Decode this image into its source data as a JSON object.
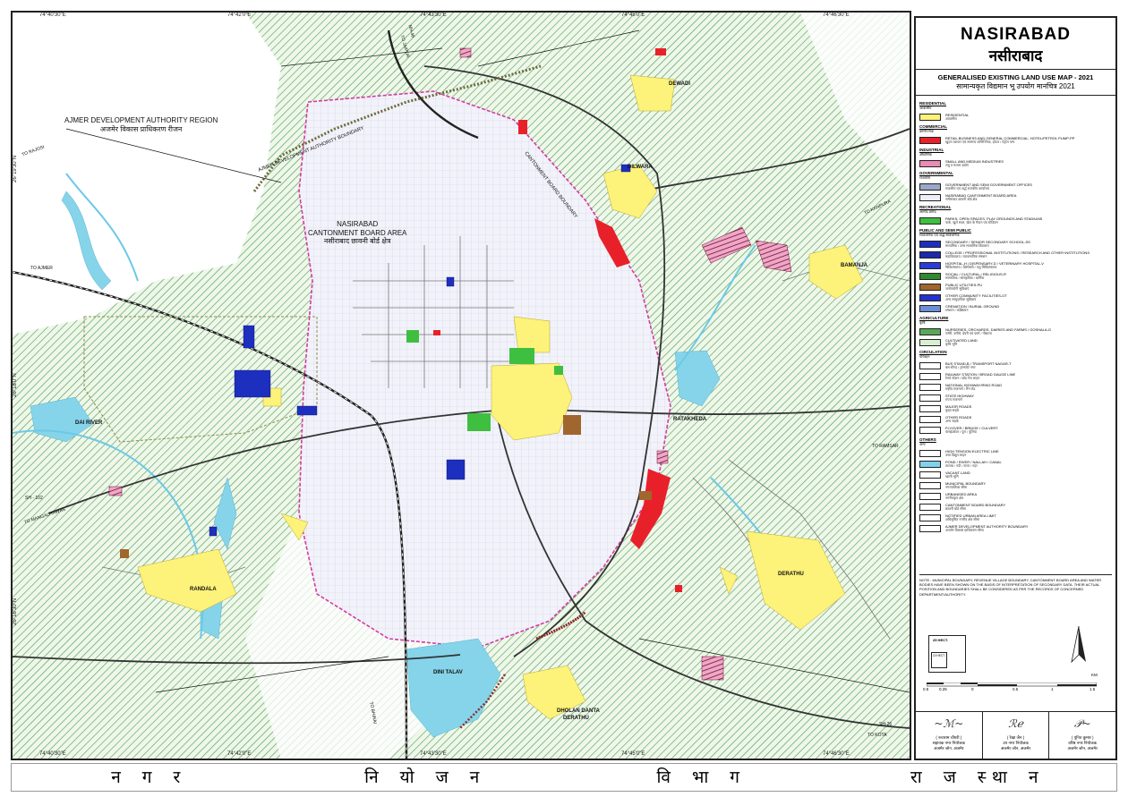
{
  "map": {
    "coords_top": [
      "74°40'30\"E",
      "74°42'0\"E",
      "74°43'30\"E",
      "74°45'0\"E",
      "74°46'30\"E"
    ],
    "coords_bottom": [
      "74°40'30\"E",
      "74°42'0\"E",
      "74°43'30\"E",
      "74°45'0\"E",
      "74°46'30\"E"
    ],
    "coords_left": [
      "26°19'30\"N",
      "26°18'0\"N",
      "26°16'30\"N"
    ],
    "places": {
      "adar_region": "AJMER DEVELOPMENT AUTHORITY REGION",
      "adar_region_hi": "अजमेर विकास प्राधिकरण रीजन",
      "cantonment": "NASIRABAD",
      "cantonment_l2": "CANTONMENT BOARD AREA",
      "cantonment_hi": "नसीराबाद छावनी बोर्ड क्षेत्र",
      "adar_boundary": "AJMER DEVELOPMENT AUTHORITY BOUNDARY",
      "cant_boundary": "CANTONMENT BOARD BOUNDARY",
      "dewadi": "DEWADI",
      "dilwara": "DILWARA",
      "bamanja": "BAMANJA",
      "ratakheda": "RATAKHEDA",
      "derathu": "DERATHU",
      "randala": "RANDALA",
      "dini_talav": "DINI TALAV",
      "dholan_danta": "DHOLAN DANTA",
      "derathu2": "DERATHU",
      "dai_river": "DAI RIVER"
    },
    "roads": {
      "to_ajmer": "TO AJMER",
      "to_rajosi": "TO RAJOSI",
      "to_kanpura": "TO KANPURA",
      "to_ramsar": "TO RAMSAR",
      "to_mangaliyawas": "TO MANGALIYAWAS",
      "to_kota": "TO KOTA",
      "to_bhinai": "TO BHINAI",
      "sh_102": "SH - 102",
      "sh_26": "SH-26",
      "nh_48": "NH-48",
      "to_jaipur": "TO JAIPUR"
    }
  },
  "legend": {
    "title_en": "NASIRABAD",
    "title_hi": "नसीराबाद",
    "subtitle_en": "GENERALISED EXISTING LAND USE MAP - 2021",
    "subtitle_hi": "सामान्यकृत विद्यमान भू उपयोग मानचित्र 2021",
    "sections": [
      {
        "cat": "RESIDENTIAL",
        "cat_hi": "आवासीय",
        "items": [
          {
            "color": "#fdf27a",
            "label": "RESIDENTIAL",
            "label_hi": "आवासीय"
          }
        ]
      },
      {
        "cat": "COMMERCIAL",
        "cat_hi": "वाणिज्यिक",
        "items": [
          {
            "color": "#e8202a",
            "label": "RETAIL BUSINESS AND GENERAL COMMERCIAL, HOTEL/PETROL PUMP-PP",
            "label_hi": "खुदरा व्यापार एवं सामान्य वाणिज्यिक, होटल / पेट्रोल पम्प"
          }
        ]
      },
      {
        "cat": "INDUSTRIAL",
        "cat_hi": "औद्योगिक",
        "items": [
          {
            "color": "#e98bb4",
            "label": "SMALL AND MEDIUM INDUSTRIES",
            "label_hi": "लघु व मध्यम उद्योग"
          }
        ]
      },
      {
        "cat": "GOVERNMENTAL",
        "cat_hi": "राजकीय",
        "items": [
          {
            "color": "#9aa7c9",
            "label": "GOVERNMENT AND SEMI GOVERNMENT OFFICES",
            "label_hi": "राजकीय एवं अर्द्ध राजकीय कार्यालय"
          },
          {
            "color": "#eeeefa",
            "label": "NASIRABAD CANTONMENT BOARD AREA",
            "label_hi": "नसीराबाद छावनी बोर्ड क्षेत्र"
          }
        ]
      },
      {
        "cat": "RECREATIONAL",
        "cat_hi": "आमोद प्रमोद",
        "items": [
          {
            "color": "#3fbf3f",
            "label": "PARKS, OPEN SPACES, PLAY GROUNDS AND STADIUMS",
            "label_hi": "पार्क, खुले स्थल, खेल के मैदान एवं स्टेडियम"
          }
        ]
      },
      {
        "cat": "PUBLIC AND SEMI PUBLIC",
        "cat_hi": "सार्वजनिक एवं अर्द्ध सार्वजनिक",
        "items": [
          {
            "color": "#1d2fbf",
            "label": "SECONDARY / SENIOR SECONDARY SCHOOL-SS",
            "label_hi": "माध्यमिक / उच्च माध्यमिक विद्यालय"
          },
          {
            "color": "#1a2aa8",
            "label": "COLLEGE / PROFESSIONAL INSTITUTIONS / RESEARCH AND OTHER INSTITUTIONS",
            "label_hi": "महाविद्यालय / व्यावसायिक संस्थान"
          },
          {
            "color": "#2a3bd8",
            "label": "HOSPITAL-H / DISPENSARY-D / VETERINARY HOSPITAL-V",
            "label_hi": "चिकित्सालय / डिस्पेंसरी / पशु चिकित्सालय"
          },
          {
            "color": "#2f8a2f",
            "label": "SOCIAL / CULTURAL / RELIGIOUS-R",
            "label_hi": "सामाजिक / सांस्कृतिक / धार्मिक"
          },
          {
            "color": "#a0662d",
            "label": "PUBLIC UTILITIES-PU",
            "label_hi": "जनोपयोगी सुविधाएं"
          },
          {
            "color": "#2233cc",
            "label": "OTHER COMMUNITY FACILITIES-OT",
            "label_hi": "अन्य सामुदायिक सुविधाएं"
          },
          {
            "color": "#6a8fd6",
            "label": "CREMATION / BURIAL GROUND",
            "label_hi": "श्मशान / कब्रिस्तान"
          }
        ]
      },
      {
        "cat": "AGRICULTURE",
        "cat_hi": "कृषि",
        "items": [
          {
            "color": "#5aa85a",
            "label": "NURSERIES, ORCHARDS, DAIRIES AND FARMS / GOSHALA-G",
            "label_hi": "नर्सरी, बगीचे, डेयरी एवं फार्म / गौशाला"
          },
          {
            "color": "#d8efd2",
            "label": "CULTIVATED LAND",
            "label_hi": "कृषि भूमि"
          }
        ]
      },
      {
        "cat": "CIRCULATION",
        "cat_hi": "परिवहन",
        "items": [
          {
            "color": "#ffffff",
            "label": "BUS STAND-B / TRANSPORT NAGAR-T",
            "label_hi": "बस स्टैण्ड / ट्रांसपोर्ट नगर"
          },
          {
            "color": "#ffffff",
            "label": "RAILWAY STATION / BROAD GAUGE LINE",
            "label_hi": "रेलवे स्टेशन / ब्रॉड गेज लाइन"
          },
          {
            "color": "#ffffff",
            "label": "NATIONAL HIGHWAY/RING ROAD",
            "label_hi": "राष्ट्रीय राजमार्ग / रिंग रोड"
          },
          {
            "color": "#ffffff",
            "label": "STATE HIGHWAY",
            "label_hi": "राज्य राजमार्ग"
          },
          {
            "color": "#ffffff",
            "label": "MAJOR ROADS",
            "label_hi": "मुख्य सड़कें"
          },
          {
            "color": "#ffffff",
            "label": "OTHER ROADS",
            "label_hi": "अन्य सड़कें"
          },
          {
            "color": "#ffffff",
            "label": "FLYOVER / BRIDGE / CULVERT",
            "label_hi": "फ्लाईओवर / पुल / पुलिया"
          }
        ]
      },
      {
        "cat": "OTHERS",
        "cat_hi": "अन्य",
        "items": [
          {
            "color": "#ffffff",
            "label": "HIGH TENSION ELECTRIC LINE",
            "label_hi": "उच्च विद्युत लाइन"
          },
          {
            "color": "#7fd3ee",
            "label": "POND / RIVER / NALLAH / CANAL",
            "label_hi": "तालाब / नदी / नाला / नहर"
          },
          {
            "color": "#ffffff",
            "label": "VACANT LAND",
            "label_hi": "खाली भूमि"
          },
          {
            "color": "#ffffff",
            "label": "MUNICIPAL BOUNDARY",
            "label_hi": "नगरपालिका सीमा"
          },
          {
            "color": "#ffffff",
            "label": "URBANISED AREA",
            "label_hi": "नगरीयकृत क्षेत्र"
          },
          {
            "color": "#ffffff",
            "label": "CANTONMENT BOARD BOUNDARY",
            "label_hi": "छावनी बोर्ड सीमा"
          },
          {
            "color": "#ffffff",
            "label": "NOTIFIED URBAN AREA LIMIT",
            "label_hi": "अधिसूचित नगरीय क्षेत्र सीमा"
          },
          {
            "color": "#ffffff",
            "label": "AJMER DEVELOPMENT AUTHORITY BOUNDARY",
            "label_hi": "अजमेर विकास प्राधिकरण सीमा"
          }
        ]
      }
    ],
    "note": "NOTE : MUNICIPAL BOUNDARY, REVENUE VILLAGE BOUNDARY, CANTONMENT BOARD AREA AND WATER BODIES HAVE BEEN SHOWN ON THE BASIS OF INTERPRETATION OF SECONDARY DATA. THEIR ACTUAL POSITION AND BOUNDARIES SHALL BE CONSIDERED AS PER THE RECORDS OF CONCERNED DEPARTMENT/AUTHORITY.",
    "scale_box_label": "25 HECT.",
    "scale_inner_label": "10 HECT.",
    "scale_ticks": [
      "0.5",
      "0.25",
      "0",
      "0.5",
      "1",
      "1.5"
    ],
    "scale_unit": "KM",
    "signatures": [
      {
        "name": "( रुचाराम चौधरी )",
        "title": "सहायक नगर नियोजक",
        "office": "अजमेर जोन, अजमेर"
      },
      {
        "name": "( रेखा जैन )",
        "title": "उप नगर नियोजक",
        "office": "अजमेर जोन, अजमेर"
      },
      {
        "name": "( पूनित कुमार )",
        "title": "वरिष्ठ नगर नियोजक",
        "office": "अजमेर जोन, अजमेर"
      }
    ]
  },
  "footer": [
    "न ग र",
    "नि यो ज न",
    "वि भा ग",
    "रा ज स्था न"
  ]
}
